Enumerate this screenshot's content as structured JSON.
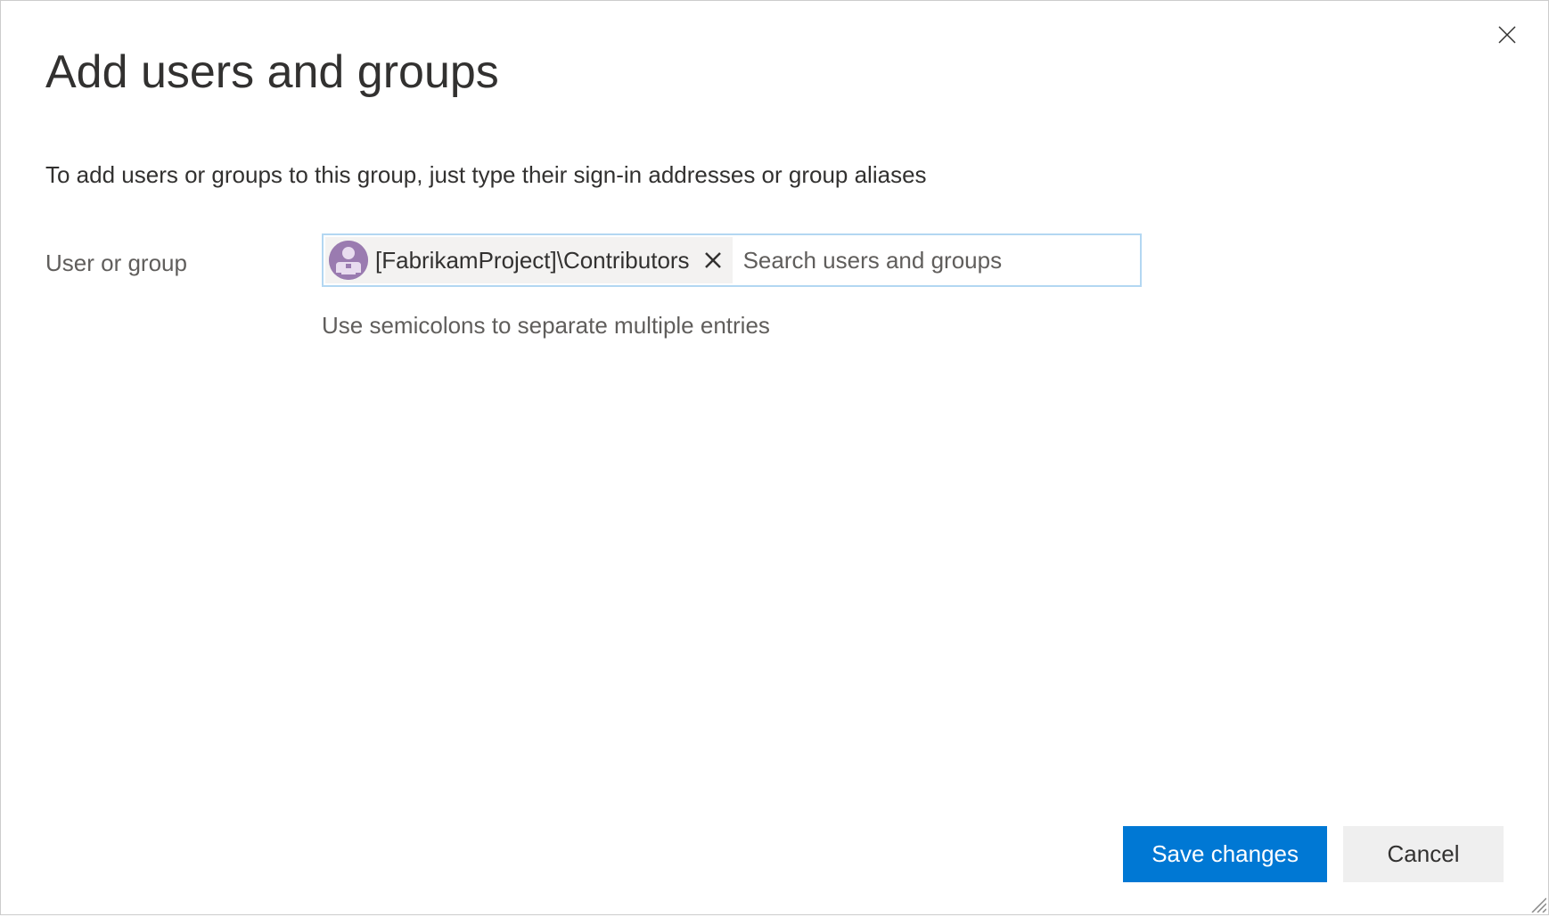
{
  "dialog": {
    "title": "Add users and groups",
    "description": "To add users or groups to this group, just type their sign-in addresses or group aliases",
    "form": {
      "label": "User or group",
      "chips": [
        {
          "label": "[FabrikamProject]\\Contributors"
        }
      ],
      "inputPlaceholder": "Search users and groups",
      "hint": "Use semicolons to separate multiple entries"
    },
    "footer": {
      "saveLabel": "Save changes",
      "cancelLabel": "Cancel"
    }
  }
}
